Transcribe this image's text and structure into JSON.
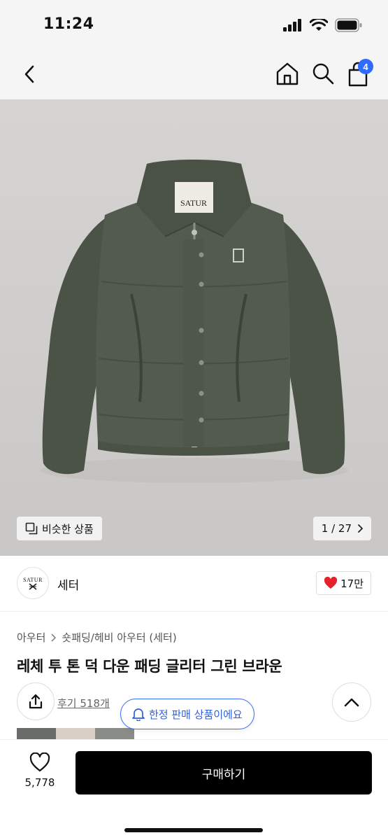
{
  "status_bar": {
    "time": "11:24",
    "icons": [
      "signal-icon",
      "wifi-icon",
      "battery-icon"
    ]
  },
  "nav": {
    "cart_badge": "4",
    "icons": [
      "back-arrow-icon",
      "home-icon",
      "search-icon",
      "shopping-bag-icon"
    ],
    "accent_color": "#2f6bff"
  },
  "product_image": {
    "similar_label": "비슷한 상품",
    "page_indicator": "1 / 27",
    "brand_tag": "SATUR"
  },
  "brand": {
    "logo_text": "SATUR",
    "name": "세터",
    "likes": "17만",
    "heart_color": "#e8202a"
  },
  "product": {
    "breadcrumb": [
      "아우터",
      "숏패딩/헤비 아우터 (세터)"
    ],
    "title": "레체 투 톤 덕 다운 패딩 글리터 그린 브라운",
    "review_link": "후기 518개",
    "limited_label": "한정 판매 상품이에요",
    "limited_color": "#2f5fe0"
  },
  "bottom_bar": {
    "wish_count": "5,778",
    "buy_label": "구매하기"
  }
}
